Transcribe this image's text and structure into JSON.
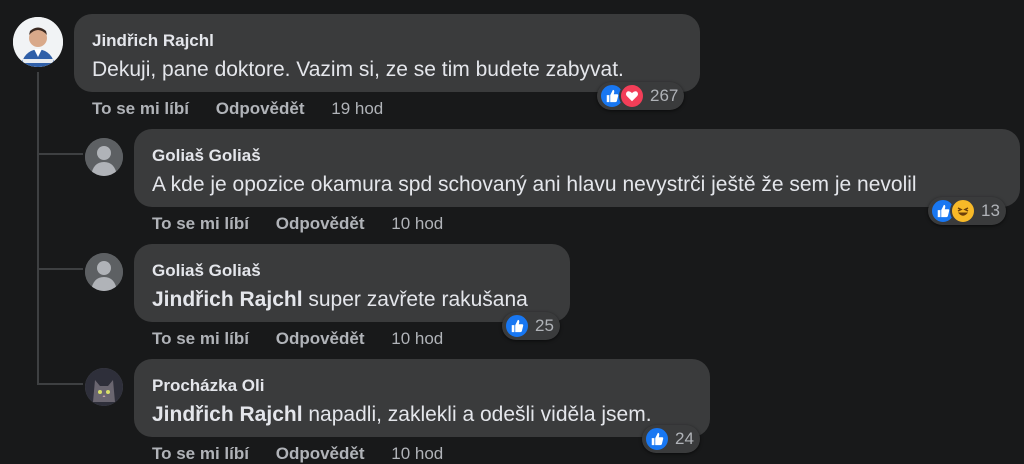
{
  "comments": [
    {
      "author": "Jindřich Rajchl",
      "mention": "",
      "text": "Dekuji, pane doktore. Vazim si, ze se tim budete zabyvat.",
      "like_label": "To se mi líbí",
      "reply_label": "Odpovědět",
      "time": "19 hod",
      "reactions": [
        "like",
        "love"
      ],
      "reaction_count": "267"
    },
    {
      "author": "Goliaš Goliaš",
      "mention": "",
      "text": "A kde je opozice okamura spd schovaný ani hlavu nevystrči ještě že sem je nevolil",
      "like_label": "To se mi líbí",
      "reply_label": "Odpovědět",
      "time": "10 hod",
      "reactions": [
        "like",
        "haha"
      ],
      "reaction_count": "13"
    },
    {
      "author": "Goliaš Goliaš",
      "mention": "Jindřich Rajchl",
      "text": " super zavřete rakušana",
      "like_label": "To se mi líbí",
      "reply_label": "Odpovědět",
      "time": "10 hod",
      "reactions": [
        "like"
      ],
      "reaction_count": "25"
    },
    {
      "author": "Procházka Oli",
      "mention": "Jindřich Rajchl",
      "text": " napadli, zaklekli a odešli viděla jsem.",
      "like_label": "To se mi líbí",
      "reply_label": "Odpovědět",
      "time": "10 hod",
      "reactions": [
        "like"
      ],
      "reaction_count": "24"
    }
  ],
  "colors": {
    "background": "#18191a",
    "bubble": "#3a3b3c",
    "like": "#1877f2",
    "love": "#f33e58",
    "haha": "#f7b928"
  }
}
